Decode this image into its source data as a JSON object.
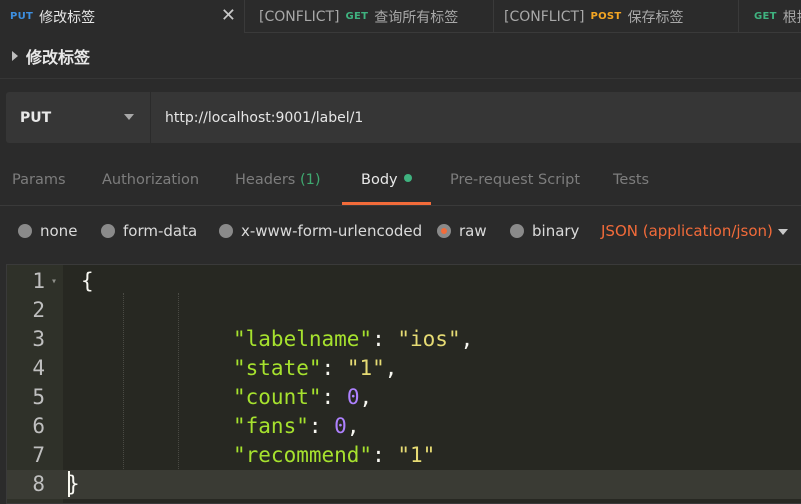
{
  "tabs": [
    {
      "method": "PUT",
      "method_color": "#3d8fe0",
      "conflict": "",
      "label": "修改标签",
      "active": true
    },
    {
      "method": "GET",
      "method_color": "#3fb27f",
      "conflict": "[CONFLICT]",
      "label": "查询所有标签",
      "active": false
    },
    {
      "method": "POST",
      "method_color": "#f5a623",
      "conflict": "[CONFLICT]",
      "label": "保存标签",
      "active": false
    },
    {
      "method": "GET",
      "method_color": "#3fb27f",
      "conflict": "",
      "label": "根据",
      "active": false
    }
  ],
  "tab_close_glyph": "✕",
  "request": {
    "title": "修改标签",
    "method": "PUT",
    "url": "http://localhost:9001/label/1"
  },
  "subtabs": {
    "params": "Params",
    "authorization": "Authorization",
    "headers": "Headers",
    "headers_count": "(1)",
    "body": "Body",
    "prerequest": "Pre-request Script",
    "tests": "Tests"
  },
  "body_types": {
    "none": "none",
    "form_data": "form-data",
    "urlencoded": "x-www-form-urlencoded",
    "raw": "raw",
    "binary": "binary",
    "selected": "raw",
    "content_type": "JSON (application/json)"
  },
  "editor": {
    "line_numbers": [
      "1",
      "2",
      "3",
      "4",
      "5",
      "6",
      "7",
      "8"
    ],
    "lines": [
      [
        {
          "t": "p",
          "v": "{"
        }
      ],
      [],
      [
        {
          "t": "k",
          "v": "\"labelname\""
        },
        {
          "t": "p",
          "v": ": "
        },
        {
          "t": "s",
          "v": "\"ios\""
        },
        {
          "t": "p",
          "v": ","
        }
      ],
      [
        {
          "t": "k",
          "v": "\"state\""
        },
        {
          "t": "p",
          "v": ": "
        },
        {
          "t": "s",
          "v": "\"1\""
        },
        {
          "t": "p",
          "v": ","
        }
      ],
      [
        {
          "t": "k",
          "v": "\"count\""
        },
        {
          "t": "p",
          "v": ": "
        },
        {
          "t": "n",
          "v": "0"
        },
        {
          "t": "p",
          "v": ","
        }
      ],
      [
        {
          "t": "k",
          "v": "\"fans\""
        },
        {
          "t": "p",
          "v": ": "
        },
        {
          "t": "n",
          "v": "0"
        },
        {
          "t": "p",
          "v": ","
        }
      ],
      [
        {
          "t": "k",
          "v": "\"recommend\""
        },
        {
          "t": "p",
          "v": ": "
        },
        {
          "t": "s",
          "v": "\"1\""
        }
      ],
      [
        {
          "t": "p",
          "v": "}"
        }
      ]
    ]
  },
  "colors": {
    "accent": "#f26b3a",
    "success": "#3fb27f"
  }
}
